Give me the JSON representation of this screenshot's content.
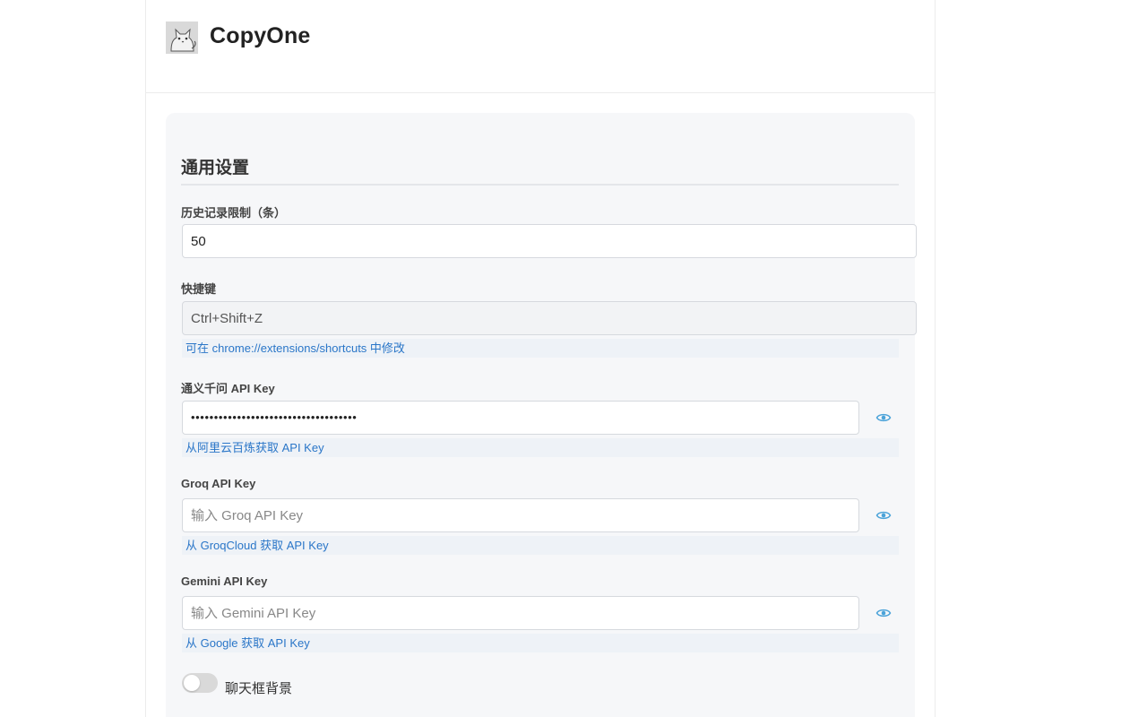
{
  "app": {
    "title": "CopyOne"
  },
  "settings": {
    "section_title": "通用设置",
    "history_limit": {
      "label": "历史记录限制（条）",
      "value": "50"
    },
    "shortcut": {
      "label": "快捷键",
      "value": "Ctrl+Shift+Z",
      "hint": "可在 chrome://extensions/shortcuts 中修改"
    },
    "qwen": {
      "label": "通义千问 API Key",
      "masked_value": "••••••••••••••••••••••••••••••••••••",
      "hint": "从阿里云百炼获取 API Key"
    },
    "groq": {
      "label": "Groq API Key",
      "placeholder": "输入 Groq API Key",
      "hint": "从 GroqCloud 获取 API Key"
    },
    "gemini": {
      "label": "Gemini API Key",
      "placeholder": "输入 Gemini API Key",
      "hint": "从 Google 获取 API Key"
    },
    "chat_background": {
      "label": "聊天框背景",
      "enabled": false
    }
  },
  "icons": {
    "logo": "cat-logo-icon",
    "eye": "eye-icon"
  },
  "colors": {
    "hint_link": "#2a76c8",
    "eye_icon": "#4ba3d9",
    "panel_bg": "#f6f7f9"
  }
}
